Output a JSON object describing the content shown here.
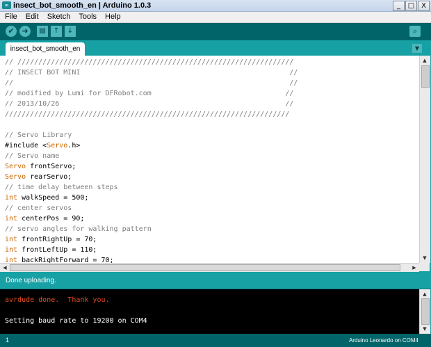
{
  "window": {
    "title": "insect_bot_smooth_en | Arduino 1.0.3",
    "app_icon": "arduino-icon",
    "controls": {
      "minimize": "_",
      "maximize": "□",
      "close": "X"
    }
  },
  "menu": [
    "File",
    "Edit",
    "Sketch",
    "Tools",
    "Help"
  ],
  "toolbar": {
    "verify_icon": "✔",
    "upload_icon": "➜",
    "new_icon": "▤",
    "open_icon": "↑",
    "save_icon": "↓",
    "serial_icon": "⌕"
  },
  "tabs": {
    "active": "insect_bot_smooth_en",
    "menu_icon": "▼"
  },
  "editor": {
    "lines": [
      {
        "seg": [
          {
            "t": "// //////////////////////////////////////////////////////////////////",
            "c": "cm"
          }
        ]
      },
      {
        "seg": [
          {
            "t": "// INSECT BOT MINI                                                  //",
            "c": "cm"
          }
        ]
      },
      {
        "seg": [
          {
            "t": "//                                                                  //",
            "c": "cm"
          }
        ]
      },
      {
        "seg": [
          {
            "t": "// modified by Lumi for DFRobot.com                                //",
            "c": "cm"
          }
        ]
      },
      {
        "seg": [
          {
            "t": "// 2013/10/26                                                      //",
            "c": "cm"
          }
        ]
      },
      {
        "seg": [
          {
            "t": "////////////////////////////////////////////////////////////////////",
            "c": "cm"
          }
        ]
      },
      {
        "seg": [
          {
            "t": "",
            "c": ""
          }
        ]
      },
      {
        "seg": [
          {
            "t": "// Servo Library",
            "c": "cm"
          }
        ]
      },
      {
        "seg": [
          {
            "t": "#include <",
            "c": ""
          },
          {
            "t": "Servo",
            "c": "kw"
          },
          {
            "t": ".h>",
            "c": ""
          }
        ]
      },
      {
        "seg": [
          {
            "t": "// Servo name",
            "c": "cm"
          }
        ]
      },
      {
        "seg": [
          {
            "t": "Servo",
            "c": "kw"
          },
          {
            "t": " frontServo;",
            "c": ""
          }
        ]
      },
      {
        "seg": [
          {
            "t": "Servo",
            "c": "kw"
          },
          {
            "t": " rearServo;",
            "c": ""
          }
        ]
      },
      {
        "seg": [
          {
            "t": "// time delay between steps",
            "c": "cm"
          }
        ]
      },
      {
        "seg": [
          {
            "t": "int",
            "c": "kw"
          },
          {
            "t": " walkSpeed = 500;",
            "c": ""
          }
        ]
      },
      {
        "seg": [
          {
            "t": "// center servos",
            "c": "cm"
          }
        ]
      },
      {
        "seg": [
          {
            "t": "int",
            "c": "kw"
          },
          {
            "t": " centerPos = 90;",
            "c": ""
          }
        ]
      },
      {
        "seg": [
          {
            "t": "// servo angles for walking pattern",
            "c": "cm"
          }
        ]
      },
      {
        "seg": [
          {
            "t": "int",
            "c": "kw"
          },
          {
            "t": " frontRightUp = 70;",
            "c": ""
          }
        ]
      },
      {
        "seg": [
          {
            "t": "int",
            "c": "kw"
          },
          {
            "t": " frontLeftUp = 110;",
            "c": ""
          }
        ]
      },
      {
        "seg": [
          {
            "t": "int",
            "c": "kw"
          },
          {
            "t": " backRightForward = 70;",
            "c": ""
          }
        ]
      }
    ]
  },
  "status": {
    "message": "Done uploading."
  },
  "console": {
    "lines": [
      "avrdude done.  Thank you.",
      "",
      "Setting baud rate to 19200 on COM4"
    ]
  },
  "footer": {
    "line_number": "1",
    "board": "Arduino Leonardo on COM4"
  },
  "colors": {
    "teal": "#17a1a5",
    "dark_teal": "#006468",
    "keyword": "#cc6600",
    "comment": "#7e7e7e",
    "console_error": "#e34c22"
  }
}
